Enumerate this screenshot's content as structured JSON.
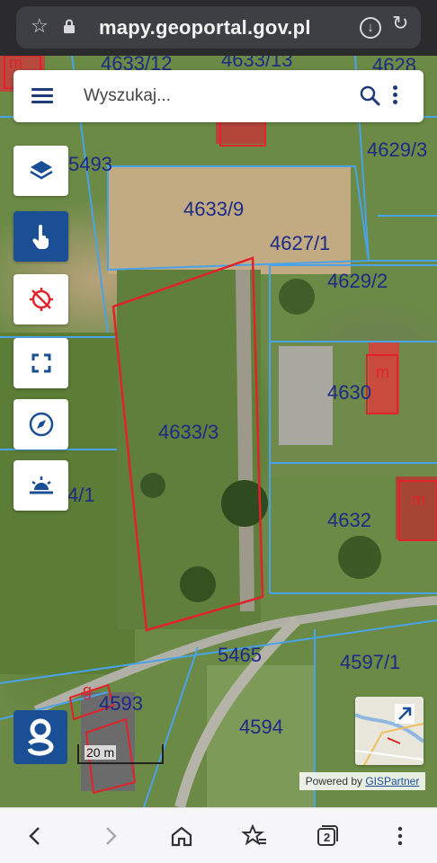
{
  "browser": {
    "url": "mapy.geoportal.gov.pl",
    "tab_count": "2"
  },
  "search": {
    "placeholder": "Wyszukaj..."
  },
  "map": {
    "parcels": [
      {
        "id": "p1",
        "label": "4633/12"
      },
      {
        "id": "p2",
        "label": "4633/13"
      },
      {
        "id": "p3",
        "label": "4628"
      },
      {
        "id": "p4",
        "label": "5493"
      },
      {
        "id": "p5",
        "label": "4629/3"
      },
      {
        "id": "p6",
        "label": "4633/9"
      },
      {
        "id": "p7",
        "label": "4627/1"
      },
      {
        "id": "p8",
        "label": "4629/2"
      },
      {
        "id": "p9",
        "label": "4630"
      },
      {
        "id": "p10",
        "label": "4633/3"
      },
      {
        "id": "p11",
        "label": "4/1"
      },
      {
        "id": "p12",
        "label": "4632"
      },
      {
        "id": "p13",
        "label": "5465"
      },
      {
        "id": "p14",
        "label": "4597/1"
      },
      {
        "id": "p15",
        "label": "4593"
      },
      {
        "id": "p16",
        "label": "4594"
      }
    ],
    "building_marks": [
      "m",
      "m",
      "m",
      "g"
    ],
    "scale_label": "20 m"
  },
  "attribution": {
    "prefix": "Powered by ",
    "link": "GISPartner"
  },
  "colors": {
    "brand": "#1a4f96",
    "parcel_line": "#4aa3e8",
    "selected_parcel": "#e0232a",
    "label": "#1d2a86"
  },
  "icons": {
    "layers": "layers-icon",
    "identify": "tap-hand-icon",
    "gps": "gps-off-icon",
    "fullscreen": "fullscreen-icon",
    "compass": "compass-icon",
    "sun": "sunrise-icon"
  }
}
